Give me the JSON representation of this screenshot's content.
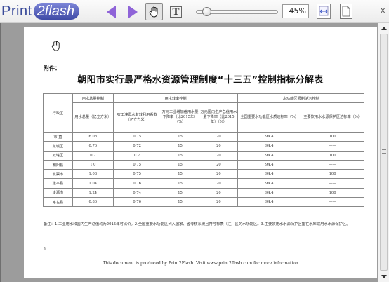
{
  "toolbar": {
    "logo_print": "Print",
    "logo_flash": "2flash",
    "zoom": "45%",
    "close_label": "x"
  },
  "document": {
    "attachment_label": "附件：",
    "title": "朝阳市实行最严格水资源管理制度“十三五”控制指标分解表",
    "group_headers": [
      "用水总量控制",
      "用水效率控制",
      "水功能区限制纳污控制"
    ],
    "row_header": "行政区",
    "sub_headers": [
      "用水总量（亿立方米）",
      "农田灌溉水有效利用系数（亿立方米）",
      "万元工业增加值用水量下降率（比2015年）（%）",
      "万元国内生产总值用水量下降率（比2015年）（%）",
      "全国重要水功能区水质达标率（%）",
      "主要饮用水水源保护区达标率（%）"
    ],
    "rows": [
      {
        "name": "市 直",
        "c1": "6.08",
        "c2": "0.75",
        "c3": "15",
        "c4": "20",
        "c5": "94.4",
        "c6": "100"
      },
      {
        "name": "龙城区",
        "c1": "0.76",
        "c2": "0.72",
        "c3": "15",
        "c4": "20",
        "c5": "94.4",
        "c6": "——"
      },
      {
        "name": "双塔区",
        "c1": "0.7",
        "c2": "0.7",
        "c3": "15",
        "c4": "20",
        "c5": "94.4",
        "c6": "100"
      },
      {
        "name": "朝阳县",
        "c1": "1.0",
        "c2": "0.75",
        "c3": "15",
        "c4": "20",
        "c5": "94.4",
        "c6": "——"
      },
      {
        "name": "北票市",
        "c1": "1.08",
        "c2": "0.75",
        "c3": "15",
        "c4": "20",
        "c5": "94.4",
        "c6": "100"
      },
      {
        "name": "建平县",
        "c1": "1.04",
        "c2": "0.76",
        "c3": "15",
        "c4": "20",
        "c5": "94.4",
        "c6": "——"
      },
      {
        "name": "凌源市",
        "c1": "1.24",
        "c2": "0.74",
        "c3": "15",
        "c4": "20",
        "c5": "94.4",
        "c6": "100"
      },
      {
        "name": "喀左县",
        "c1": "0.86",
        "c2": "0.76",
        "c3": "15",
        "c4": "20",
        "c5": "94.4",
        "c6": "——"
      }
    ],
    "note": "备注：1.工业用水和国内生产总值均为2015年可比价。2.全国重要水功能区列入国家、省考核系统且符号标表（注）区的水功能区。3.主要饮用水水源保护区指在水库饮用水水源保护区。",
    "page_number": "1",
    "footer": "This document is produced by Print2Flash. Visit www.print2flash.com for more information"
  }
}
